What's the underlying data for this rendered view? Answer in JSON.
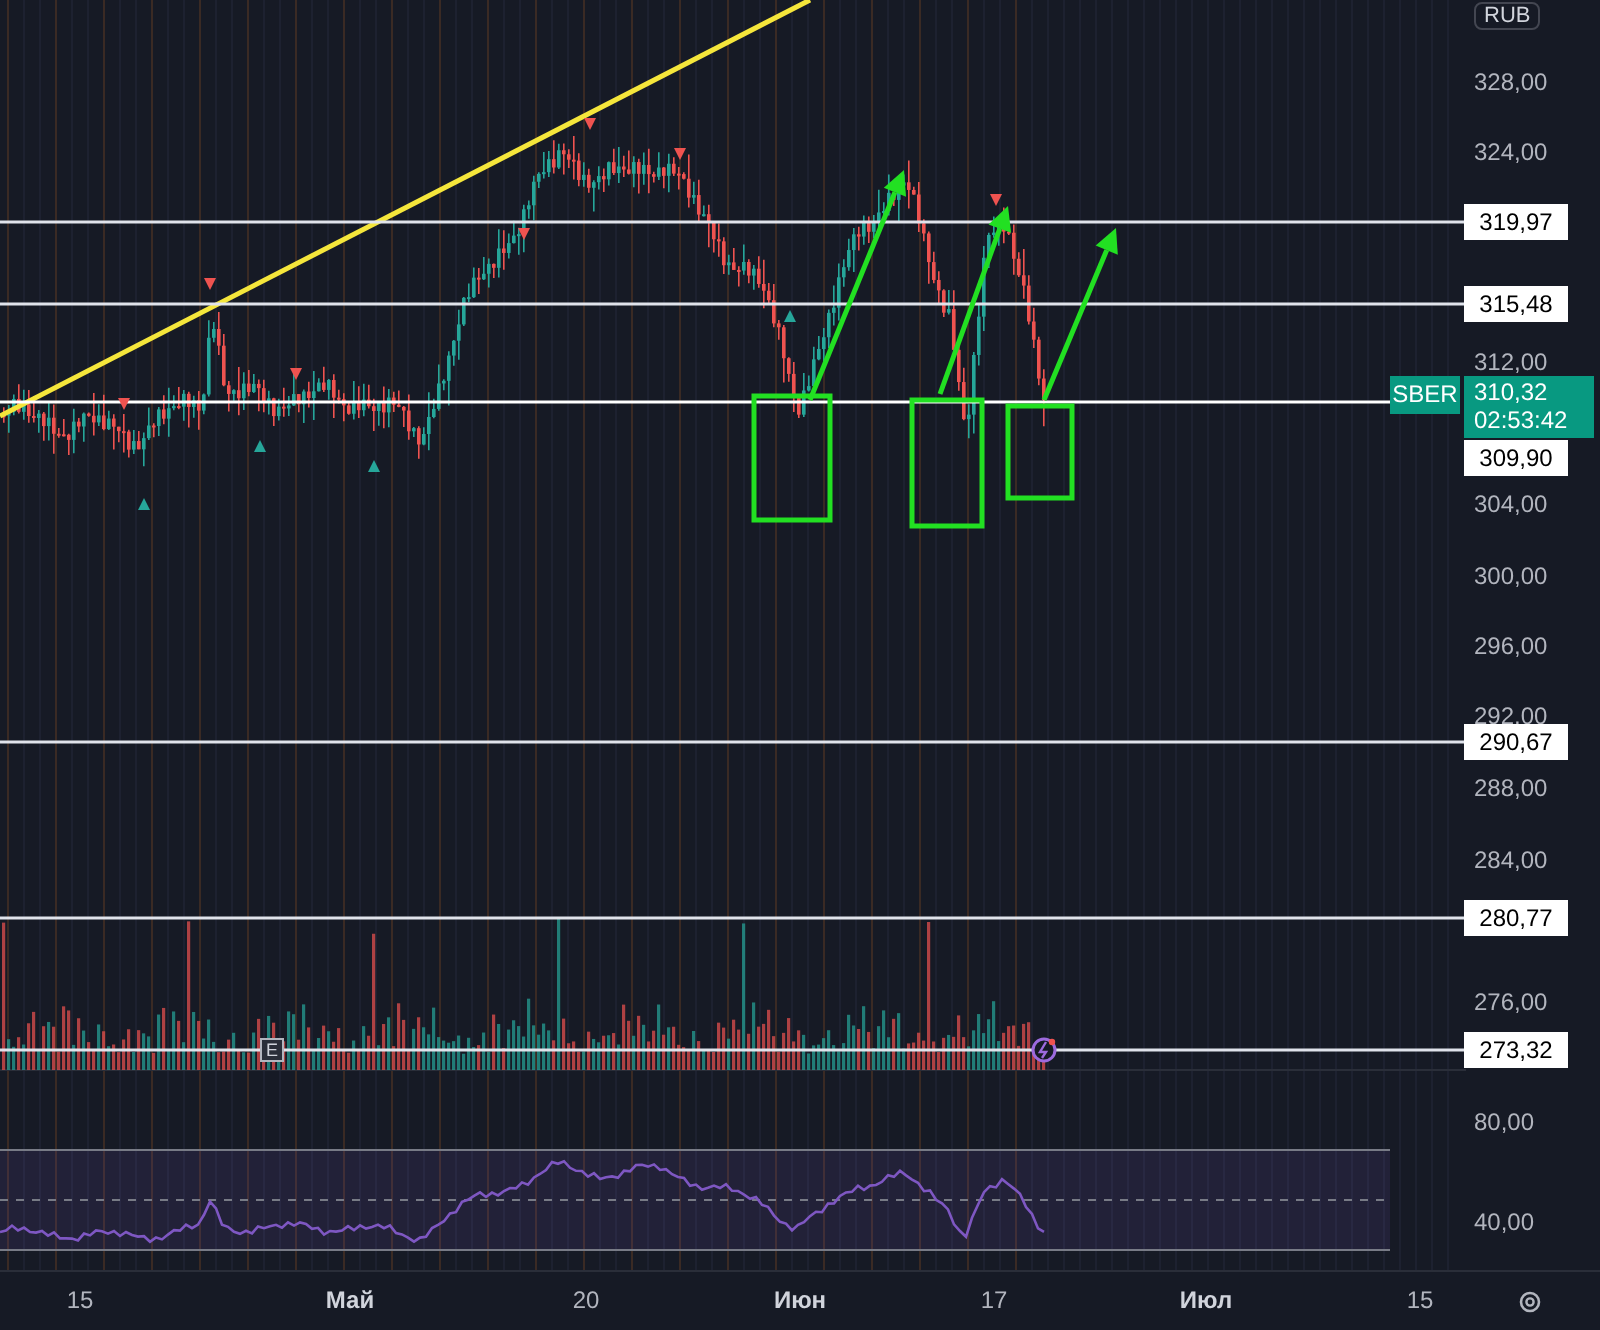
{
  "currency": "RUB",
  "price_ticks": [
    "328,00",
    "324,00",
    "312,00",
    "304,00",
    "300,00",
    "296,00",
    "292,00",
    "288,00",
    "284,00",
    "276,00"
  ],
  "levels": [
    {
      "price": "319,97"
    },
    {
      "price": "315,48"
    },
    {
      "price": "290,67"
    },
    {
      "price": "280,77"
    },
    {
      "price": "273,32"
    }
  ],
  "marker_price": "309,90",
  "current": {
    "symbol": "SBER",
    "price": "310,32",
    "countdown": "02:53:42"
  },
  "rsi_ticks": [
    "80,00",
    "40,00"
  ],
  "event_marker": "E",
  "time_ticks": [
    {
      "label": "15",
      "kind": "day"
    },
    {
      "label": "Май",
      "kind": "month"
    },
    {
      "label": "20",
      "kind": "day"
    },
    {
      "label": "Июн",
      "kind": "month"
    },
    {
      "label": "17",
      "kind": "day"
    },
    {
      "label": "Июл",
      "kind": "month"
    },
    {
      "label": "15",
      "kind": "day"
    }
  ]
}
